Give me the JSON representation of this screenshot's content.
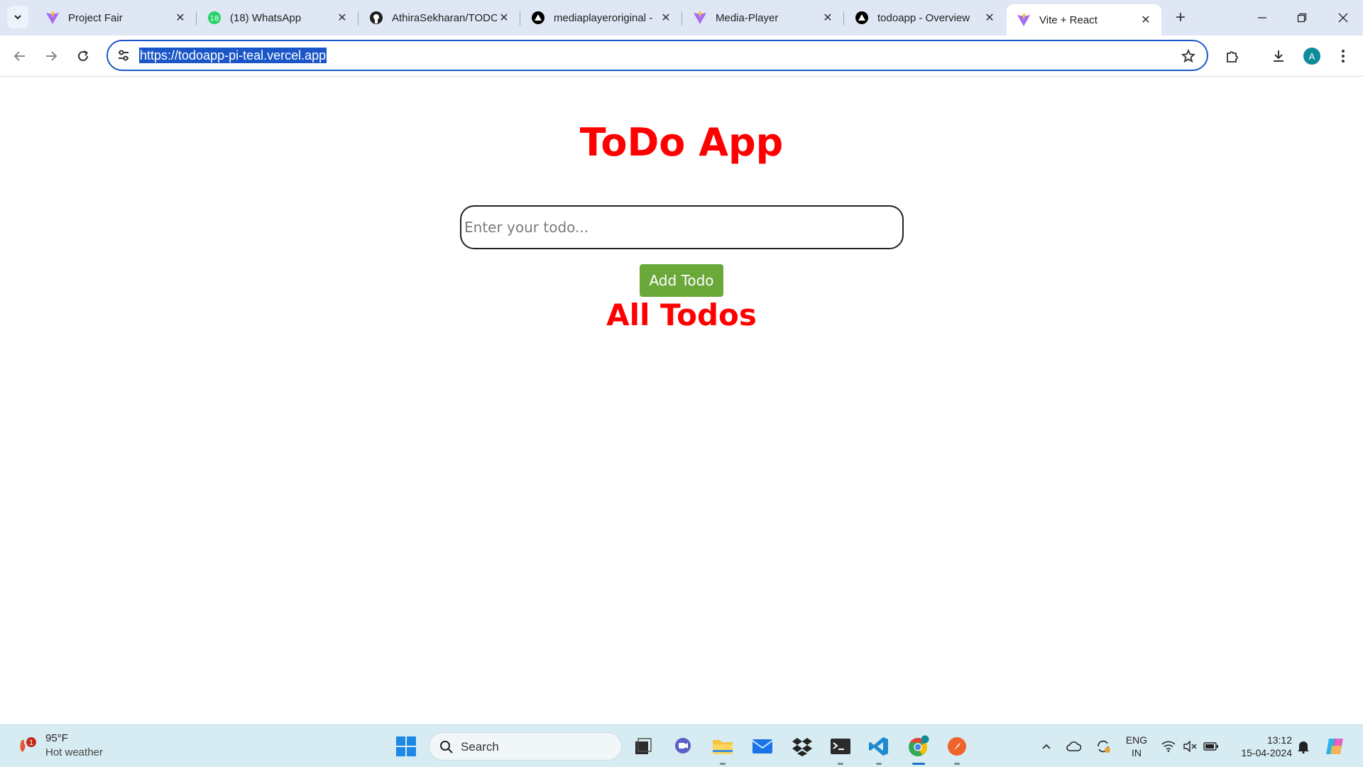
{
  "browser": {
    "tabs": [
      {
        "title": "Project Fair",
        "favicon": "vite-icon"
      },
      {
        "title": "(18) WhatsApp",
        "favicon": "whatsapp-icon",
        "badge": "18"
      },
      {
        "title": "AthiraSekharan/TODO",
        "favicon": "github-icon"
      },
      {
        "title": "mediaplayeroriginal -",
        "favicon": "vercel-icon"
      },
      {
        "title": "Media-Player",
        "favicon": "vite-icon"
      },
      {
        "title": "todoapp - Overview",
        "favicon": "vercel-icon"
      },
      {
        "title": "Vite + React",
        "favicon": "vite-icon",
        "active": true
      }
    ],
    "url": "https://todoapp-pi-teal.vercel.app",
    "profile_initial": "A"
  },
  "page": {
    "title": "ToDo App",
    "input_placeholder": "Enter your todo...",
    "input_value": "",
    "add_button_label": "Add Todo",
    "list_heading": "All Todos",
    "todos": []
  },
  "taskbar": {
    "weather": {
      "temp": "95°F",
      "desc": "Hot weather",
      "alert_count": "1"
    },
    "search_label": "Search",
    "language": {
      "line1": "ENG",
      "line2": "IN"
    },
    "clock": {
      "time": "13:12",
      "date": "15-04-2024"
    },
    "pinned": [
      "task-view",
      "chat",
      "file-explorer",
      "mail",
      "dropbox",
      "terminal",
      "vscode",
      "chrome",
      "brave"
    ]
  },
  "colors": {
    "accent_red": "#ff0000",
    "button_green": "#6aa83a",
    "omnibox_blue": "#1a56c8",
    "tabstrip_bg": "#dfe7f5",
    "taskbar_bg": "#d7ecf2"
  }
}
